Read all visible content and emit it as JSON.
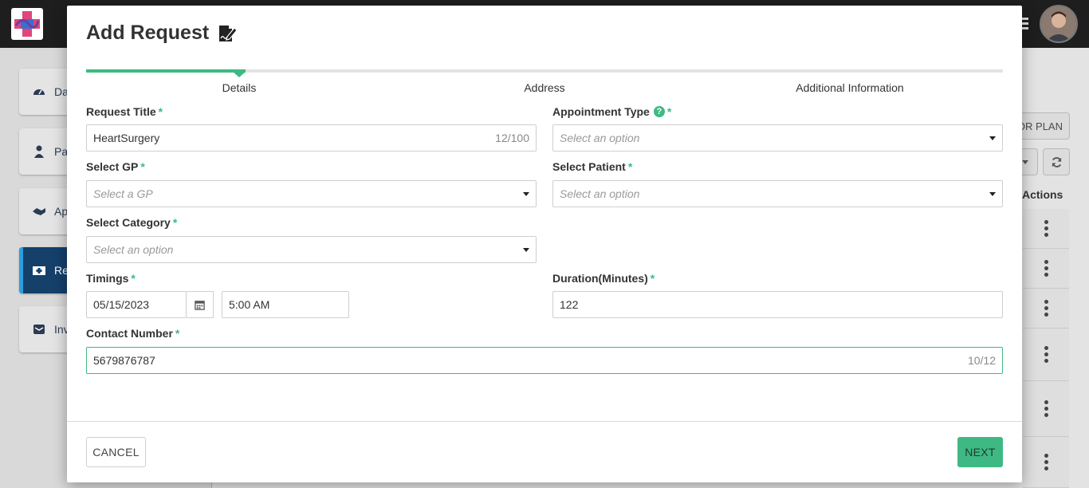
{
  "background": {
    "sidebar": {
      "items": [
        {
          "label": "Da",
          "icon": "dashboard-icon"
        },
        {
          "label": "Pa",
          "icon": "patient-icon"
        },
        {
          "label": "Ap",
          "icon": "handshake-icon"
        },
        {
          "label": "Re",
          "icon": "medical-kit-icon",
          "active": true
        },
        {
          "label": "Inv",
          "icon": "envelope-icon"
        }
      ]
    },
    "plan_button": "OR PLAN",
    "actions_header": "Actions"
  },
  "modal": {
    "title": "Add Request",
    "title_icon": "signature-document-icon",
    "steps": [
      "Details",
      "Address",
      "Additional Information"
    ],
    "active_step": 0,
    "fields": {
      "request_title": {
        "label": "Request Title",
        "value": "HeartSurgery",
        "counter": "12/100"
      },
      "appointment_type": {
        "label": "Appointment Type",
        "placeholder": "Select an option"
      },
      "select_gp": {
        "label": "Select GP",
        "placeholder": "Select a GP"
      },
      "select_patient": {
        "label": "Select Patient",
        "placeholder": "Select an option"
      },
      "select_category": {
        "label": "Select Category",
        "placeholder": "Select an option"
      },
      "timings": {
        "label": "Timings",
        "date": "05/15/2023",
        "time": "5:00 AM"
      },
      "duration": {
        "label": "Duration(Minutes)",
        "value": "122"
      },
      "contact_number": {
        "label": "Contact Number",
        "value": "5679876787",
        "counter": "10/12"
      }
    },
    "required_mark": "*",
    "help_mark": "?",
    "buttons": {
      "cancel": "CANCEL",
      "next": "NEXT"
    }
  },
  "colors": {
    "accent": "#3fb983",
    "topbar": "#1e1e1e",
    "sidebar_active": "#14406a"
  }
}
